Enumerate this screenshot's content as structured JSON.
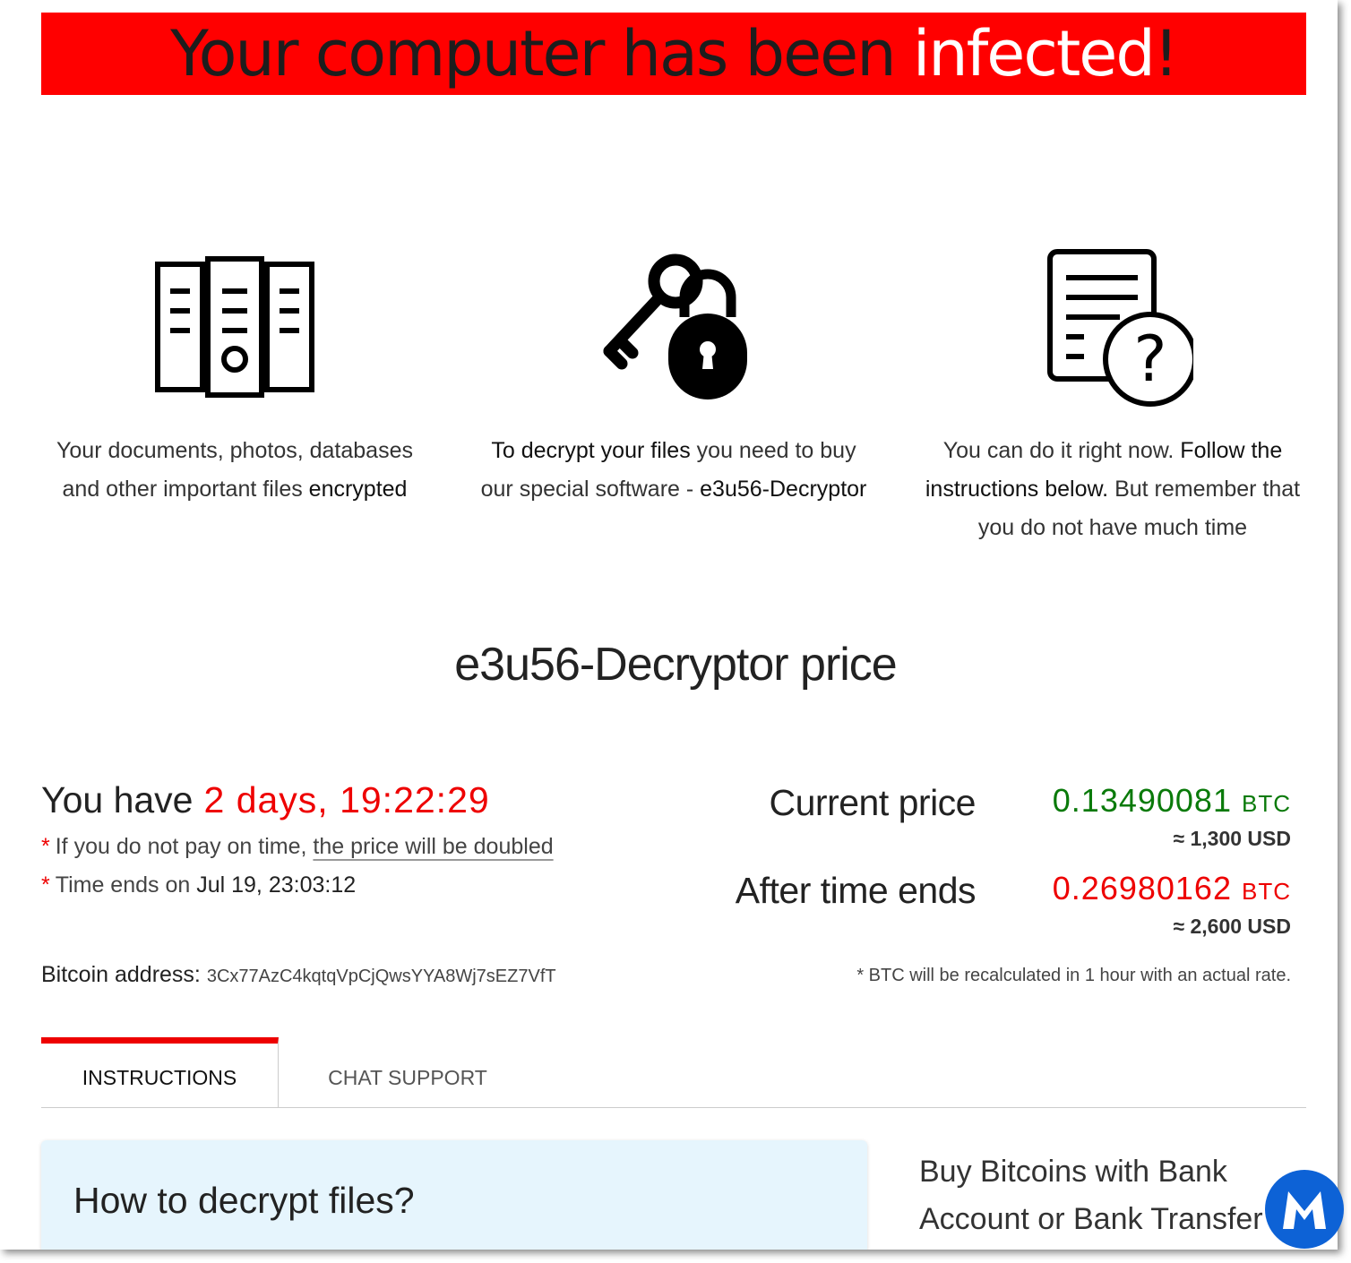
{
  "banner": {
    "part1": "Your computer has been ",
    "part2": "infected",
    "part3": "!"
  },
  "features": [
    {
      "icon": "file-cabinet-icon",
      "text_plain": "Your documents, photos, databases and other important files ",
      "text_bold": "encrypted"
    },
    {
      "icon": "key-lock-icon",
      "text_bold1": "To decrypt your files",
      "text_plain": " you need to buy our special software - ",
      "text_bold2": "e3u56-Decryptor"
    },
    {
      "icon": "document-question-icon",
      "text_plain1": "You can do it right now. ",
      "text_bold": "Follow the instructions below.",
      "text_plain2": " But remember that you do not have much time"
    }
  ],
  "price_title": "e3u56-Decryptor price",
  "countdown": {
    "label": "You have",
    "timer": "2 days, 19:22:29"
  },
  "notes": {
    "star": "*",
    "note1_plain": "If you do not pay on time, ",
    "note1_underline": "the price will be doubled",
    "note2_plain": "Time ends on ",
    "note2_date": "Jul 19, 23:03:12"
  },
  "bitcoin": {
    "label": "Bitcoin address:",
    "address": "3Cx77AzC4kqtqVpCjQwsYYA8Wj7sEZ7VfT"
  },
  "current": {
    "label": "Current price",
    "btc": "0.13490081",
    "unit": "BTC",
    "usd": "≈ 1,300 USD",
    "color": "#0a7a0a"
  },
  "after": {
    "label": "After time ends",
    "btc": "0.26980162",
    "unit": "BTC",
    "usd": "≈ 2,600 USD",
    "color": "#e00000"
  },
  "recalc": "* BTC will be recalculated in 1 hour with an actual rate.",
  "tabs": {
    "instructions": "INSTRUCTIONS",
    "chat": "CHAT SUPPORT"
  },
  "howto": {
    "title": "How to decrypt files?"
  },
  "buy": {
    "line1": "Buy Bitcoins with Bank",
    "line2": "Account or Bank Transfer"
  },
  "colors": {
    "accent": "#ff0000",
    "panel": "#e6f5fd",
    "logo": "#0d62d6"
  }
}
